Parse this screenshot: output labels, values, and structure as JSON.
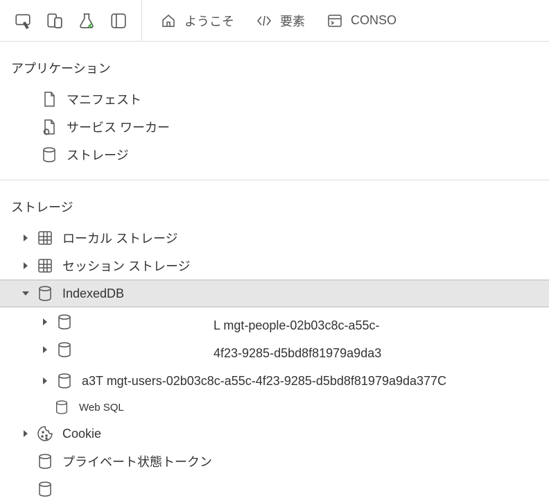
{
  "toolbar": {
    "tabs": [
      {
        "label": "ようこそ"
      },
      {
        "label": "要素"
      },
      {
        "label": "CONSO"
      }
    ]
  },
  "sections": {
    "application": {
      "title": "アプリケーション",
      "items": [
        {
          "label": "マニフェスト"
        },
        {
          "label": "サービス ワーカー"
        },
        {
          "label": "ストレージ"
        }
      ]
    },
    "storage": {
      "title": "ストレージ",
      "localStorage": {
        "label": "ローカル ストレージ"
      },
      "sessionStorage": {
        "label": "セッション ストレージ"
      },
      "indexeddb": {
        "label": "IndexedDB"
      },
      "db_line1": "L mgt-people-02b03c8c-a55c-",
      "db_line2": "4f23-9285-d5bd8f81979a9da3",
      "db2": "a3T mgt-users-02b03c8c-a55c-4f23-9285-d5bd8f81979a9da377C",
      "websql": {
        "label": "Web SQL"
      },
      "cookie": {
        "label": "Cookie"
      },
      "privateState": {
        "label": "プライベート状態トークン"
      }
    }
  }
}
